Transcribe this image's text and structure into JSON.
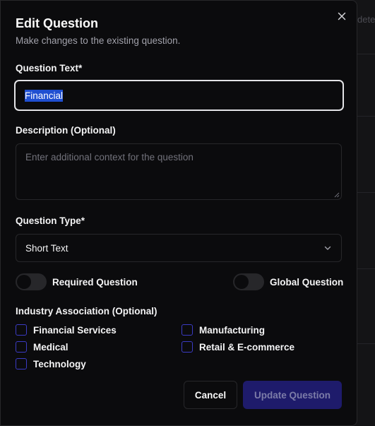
{
  "background": {
    "peek_text": "dete"
  },
  "dialog": {
    "title": "Edit Question",
    "subtitle": "Make changes to the existing question.",
    "close_icon": "x-close-icon",
    "question_text": {
      "label": "Question Text*",
      "value": "Financial"
    },
    "description": {
      "label": "Description (Optional)",
      "placeholder": "Enter additional context for the question",
      "value": ""
    },
    "question_type": {
      "label": "Question Type*",
      "selected": "Short Text"
    },
    "toggles": [
      {
        "label": "Required Question",
        "on": false
      },
      {
        "label": "Global Question",
        "on": false
      }
    ],
    "industry": {
      "label": "Industry Association (Optional)",
      "options": [
        {
          "label": "Financial Services",
          "checked": false
        },
        {
          "label": "Manufacturing",
          "checked": false
        },
        {
          "label": "Medical",
          "checked": false
        },
        {
          "label": "Retail & E-commerce",
          "checked": false
        },
        {
          "label": "Technology",
          "checked": false
        }
      ]
    },
    "buttons": {
      "cancel": "Cancel",
      "update": "Update Question"
    }
  },
  "colors": {
    "accent": "#1e1b6b",
    "checkbox_border": "#3b3bc4",
    "selection": "#1f4fd1"
  }
}
